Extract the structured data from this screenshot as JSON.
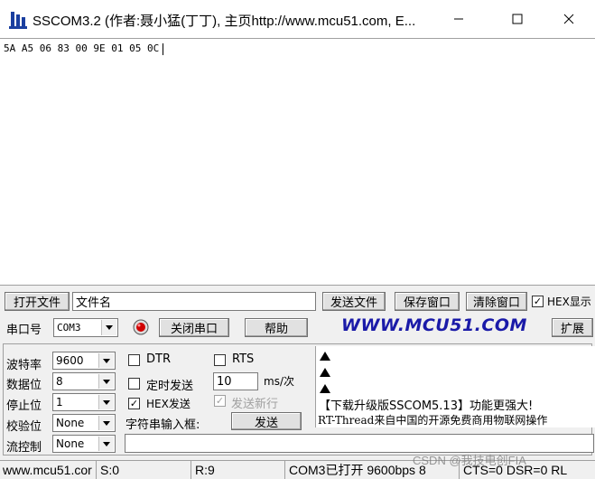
{
  "window": {
    "title": "SSCOM3.2 (作者:聂小猛(丁丁), 主页http://www.mcu51.com,  E...",
    "controls": [
      "minimize-icon",
      "maximize-icon",
      "close-icon"
    ]
  },
  "receive": {
    "text": "5A A5 06 83 00 9E 01 05 0C"
  },
  "toolbar": {
    "open_file": "打开文件",
    "filename_value": "文件名",
    "send_file": "发送文件",
    "save_window": "保存窗口",
    "clear_window": "清除窗口",
    "hex_display": "HEX显示",
    "hex_display_checked": true
  },
  "port": {
    "label": "串口号",
    "value": "COM3",
    "close_port": "关闭串口",
    "help": "帮助",
    "website": "WWW.MCU51.COM",
    "extend": "扩展",
    "led_color": "#d00000"
  },
  "settings": {
    "baud_label": "波特率",
    "baud_value": "9600",
    "data_bits_label": "数据位",
    "data_bits_value": "8",
    "stop_bits_label": "停止位",
    "stop_bits_value": "1",
    "parity_label": "校验位",
    "parity_value": "None",
    "flow_label": "流控制",
    "flow_value": "None"
  },
  "options": {
    "dtr": "DTR",
    "rts": "RTS",
    "timed_send": "定时发送",
    "interval_value": "10",
    "interval_unit": "ms/次",
    "hex_send": "HEX发送",
    "hex_send_checked": true,
    "send_newline": "发送新行",
    "send_newline_checked": true,
    "input_label": "字符串输入框:",
    "send": "发送",
    "input_value": ""
  },
  "info": {
    "line1": "【下载升级版SSCOM5.13】功能更强大!",
    "line2": "RT-Thread来自中国的开源免费商用物联网操作"
  },
  "status": {
    "site": "www.mcu51.cor",
    "sent": "S:0",
    "received": "R:9",
    "port_state": "COM3已打开  9600bps  8",
    "signals": "CTS=0 DSR=0 RL"
  },
  "watermark": "CSDN @我技电创FIA"
}
